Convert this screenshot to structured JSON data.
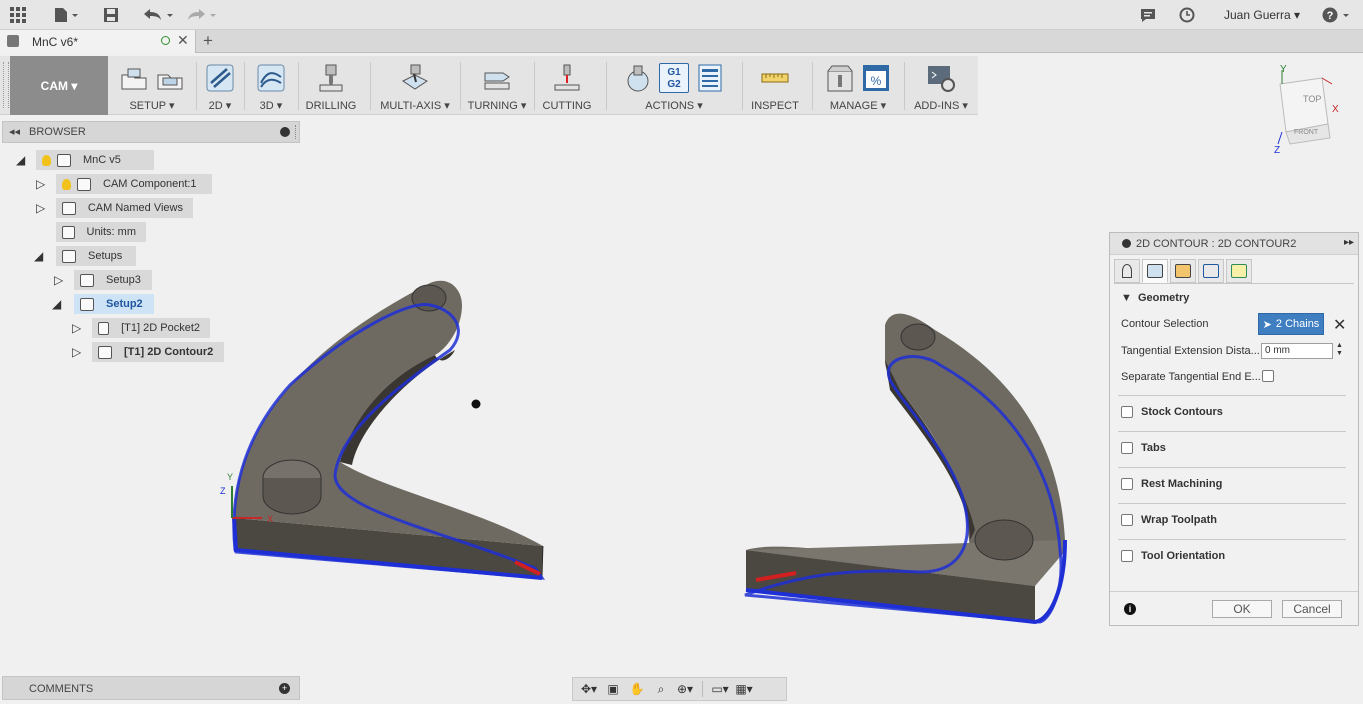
{
  "app": {
    "user_name": "Juan Guerra",
    "icons": [
      "grid-menu-icon",
      "file-icon",
      "save-icon",
      "undo-icon",
      "redo-icon",
      "comment-icon",
      "clock-icon",
      "help-icon"
    ]
  },
  "document_tab": {
    "title": "MnC v6*"
  },
  "ribbon": {
    "workspace": "CAM",
    "groups": [
      {
        "label": "SETUP",
        "dropdown": true
      },
      {
        "label": "2D",
        "dropdown": true
      },
      {
        "label": "3D",
        "dropdown": true
      },
      {
        "label": "DRILLING",
        "dropdown": false
      },
      {
        "label": "MULTI-AXIS",
        "dropdown": true
      },
      {
        "label": "TURNING",
        "dropdown": true
      },
      {
        "label": "CUTTING",
        "dropdown": false
      },
      {
        "label": "ACTIONS",
        "dropdown": true
      },
      {
        "label": "INSPECT",
        "dropdown": false
      },
      {
        "label": "MANAGE",
        "dropdown": true
      },
      {
        "label": "ADD-INS",
        "dropdown": true
      }
    ],
    "actions_icon_text": [
      "G1",
      "G2"
    ]
  },
  "browser": {
    "title": "BROWSER",
    "tree": [
      {
        "label": "MnC v5"
      },
      {
        "label": "CAM Component:1"
      },
      {
        "label": "CAM Named Views"
      },
      {
        "label": "Units: mm"
      },
      {
        "label": "Setups"
      },
      {
        "label": "Setup3"
      },
      {
        "label": "Setup2"
      },
      {
        "label": "[T1] 2D Pocket2"
      },
      {
        "label": "[T1] 2D Contour2"
      }
    ]
  },
  "comments": {
    "title": "COMMENTS"
  },
  "viewcube": {
    "top": "TOP",
    "front": "FRONT",
    "axes": [
      "Y",
      "X",
      "Z"
    ]
  },
  "viewport": {
    "axes": [
      "Y",
      "Z",
      "X"
    ]
  },
  "dialog": {
    "title": "2D CONTOUR : 2D CONTOUR2",
    "section": "Geometry",
    "contour_selection_label": "Contour Selection",
    "contour_selection_value": "2 Chains",
    "tangential_extension_label": "Tangential Extension Dista...",
    "tangential_extension_value": "0 mm",
    "separate_tangential_label": "Separate Tangential End E...",
    "groups": [
      "Stock Contours",
      "Tabs",
      "Rest Machining",
      "Wrap Toolpath",
      "Tool Orientation"
    ],
    "ok_label": "OK",
    "cancel_label": "Cancel"
  },
  "colors": {
    "cam_button": "#8c8c8c",
    "toolpath": "#1f2fd6",
    "part": "#6f6a61",
    "selected_chip": "#cfe3f6",
    "chain_button": "#3f7fc1"
  }
}
